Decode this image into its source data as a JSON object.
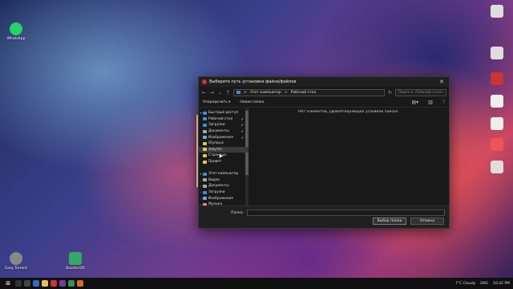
{
  "desktop": {
    "left_icons": [
      {
        "label": "WhatsApp",
        "color": "#25d366"
      },
      {
        "label": "Easy Torrent",
        "color": "#888"
      },
      {
        "label": "BoosterOS",
        "color": "#3a6"
      }
    ],
    "right_icons": [
      {
        "label": "",
        "color": "#ddd"
      },
      {
        "label": "",
        "color": "#ddd"
      },
      {
        "label": "",
        "color": "#c33"
      },
      {
        "label": "",
        "color": "#eee"
      },
      {
        "label": "",
        "color": "#e55"
      },
      {
        "label": "",
        "color": "#ddd"
      }
    ]
  },
  "dialog": {
    "title": "Выберите путь установки файла/файлов",
    "nav": {
      "path_pc": "Этот компьютер",
      "path_sep": ">",
      "path_current": "Рабочий стол",
      "search_placeholder": "Поиск в: Рабочий стол"
    },
    "toolbar": {
      "organize": "Упорядочить ▾",
      "new_folder": "Новая папка"
    },
    "sidebar": [
      {
        "label": "Быстрый доступ",
        "chev": "▾",
        "icon_color": "#3b8fd9",
        "pinned": false
      },
      {
        "label": "Рабочий стол",
        "chev": "",
        "icon_color": "#3b8fd9",
        "pinned": true
      },
      {
        "label": "Загрузки",
        "chev": "",
        "icon_color": "#3b8fd9",
        "pinned": true
      },
      {
        "label": "Документы",
        "chev": "",
        "icon_color": "#aaa",
        "pinned": true
      },
      {
        "label": "Изображения",
        "chev": "",
        "icon_color": "#6aa8e8",
        "pinned": true
      },
      {
        "label": "Olympus",
        "chev": "",
        "icon_color": "#e8c15a",
        "pinned": false
      },
      {
        "label": "skeyrim",
        "chev": "",
        "icon_color": "#e8c15a",
        "pinned": false,
        "selected": true
      },
      {
        "label": "Страница",
        "chev": "",
        "icon_color": "#e8c15a",
        "pinned": false
      },
      {
        "label": "Привет",
        "chev": "",
        "icon_color": "#e8c15a",
        "pinned": false
      },
      {
        "label": "",
        "chev": "",
        "icon_color": "",
        "pinned": false
      },
      {
        "label": "Этот компьютер",
        "chev": "▾",
        "icon_color": "#3b8fd9",
        "pinned": false
      },
      {
        "label": "Видео",
        "chev": "›",
        "icon_color": "#aaa",
        "pinned": false
      },
      {
        "label": "Документы",
        "chev": "›",
        "icon_color": "#aaa",
        "pinned": false
      },
      {
        "label": "Загрузки",
        "chev": "›",
        "icon_color": "#3b8fd9",
        "pinned": false
      },
      {
        "label": "Изображения",
        "chev": "›",
        "icon_color": "#6aa8e8",
        "pinned": false
      },
      {
        "label": "Музыка",
        "chev": "›",
        "icon_color": "#e88",
        "pinned": false
      }
    ],
    "empty_message": "Нет элементов, удовлетворяющих условиям поиска.",
    "folder_label": "Папка:",
    "folder_value": "",
    "select_button": "Выбор папки",
    "cancel_button": "Отмена"
  },
  "taskbar": {
    "weather": "7°C Cloudy",
    "lang": "ENG",
    "time": "10:42 PM"
  }
}
